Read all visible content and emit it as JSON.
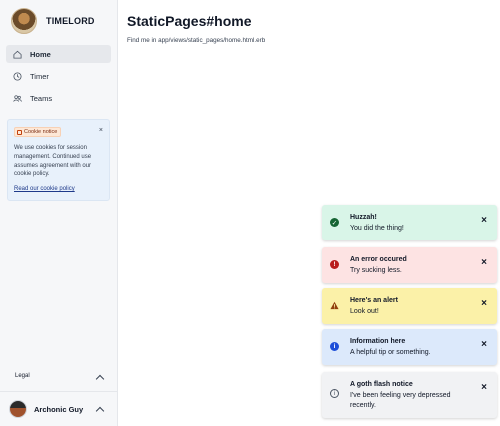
{
  "brand": {
    "name": "TIMELORD"
  },
  "nav": [
    {
      "label": "Home",
      "icon": "home-icon",
      "active": true
    },
    {
      "label": "Timer",
      "icon": "clock-icon",
      "active": false
    },
    {
      "label": "Teams",
      "icon": "users-icon",
      "active": false
    }
  ],
  "cookie_notice": {
    "badge": "Cookie notice",
    "text": "We use cookies for session management. Continued use assumes agreement with our cookie policy.",
    "link": "Read our cookie policy",
    "close": "×"
  },
  "footer": {
    "legal": "Legal",
    "user_name": "Archonic Guy"
  },
  "page": {
    "title": "StaticPages#home",
    "subtitle": "Find me in app/views/static_pages/home.html.erb"
  },
  "toasts": [
    {
      "kind": "success",
      "title": "Huzzah!",
      "message": "You did the thing!",
      "icon": "check-circle-icon",
      "bg": "#d9f5e8",
      "iconColor": "#166534"
    },
    {
      "kind": "error",
      "title": "An error occured",
      "message": "Try sucking less.",
      "icon": "alert-circle-icon",
      "bg": "#fde3e3",
      "iconColor": "#b91c1c"
    },
    {
      "kind": "alert",
      "title": "Here's an alert",
      "message": "Look out!",
      "icon": "warning-triangle-icon",
      "bg": "#fbf1a8",
      "iconColor": "#92400e"
    },
    {
      "kind": "info",
      "title": "Information here",
      "message": "A helpful tip or something.",
      "icon": "info-circle-icon",
      "bg": "#dce9fb",
      "iconColor": "#1d4ed8"
    },
    {
      "kind": "goth",
      "title": "A goth flash notice",
      "message": "I've been feeling very depressed recently.",
      "icon": "info-outline-icon",
      "bg": "#f1f2f4",
      "iconColor": "#4b5563"
    }
  ]
}
